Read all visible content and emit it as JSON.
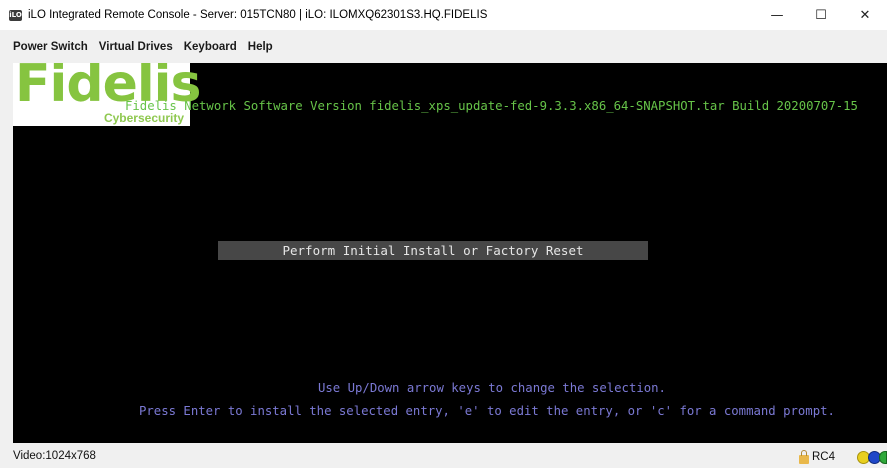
{
  "window": {
    "title": "iLO Integrated Remote Console - Server: 015TCN80 | iLO: ILOMXQ62301S3.HQ.FIDELIS",
    "app_icon_text": "iLO",
    "controls": {
      "minimize": "—",
      "maximize": "☐",
      "close": "✕"
    }
  },
  "menubar": {
    "items": [
      {
        "label": "Power Switch"
      },
      {
        "label": "Virtual Drives"
      },
      {
        "label": "Keyboard"
      },
      {
        "label": "Help"
      }
    ]
  },
  "console": {
    "logo": {
      "word": "Fidelis",
      "subtitle": "Cybersecurity"
    },
    "version_line": "Fidelis Network Software Version fidelis_xps_update-fed-9.3.3.x86_64-SNAPSHOT.tar Build 20200707-15",
    "menu_entry": "Perform Initial Install or Factory Reset",
    "hint_line_1": "Use Up/Down arrow keys to change the selection.",
    "hint_line_2": "Press Enter to install the selected entry, 'e' to edit the entry, or 'c' for a command prompt.",
    "colors": {
      "background": "#000000",
      "version_text": "#67c449",
      "hint_text": "#7b79d4",
      "selected_entry_bg": "#474747"
    }
  },
  "statusbar": {
    "video": "Video:1024x768",
    "encryption": "RC4",
    "icons": [
      "lock-icon",
      "yellow-status-icon",
      "blue-status-icon",
      "green-status-icon"
    ]
  }
}
